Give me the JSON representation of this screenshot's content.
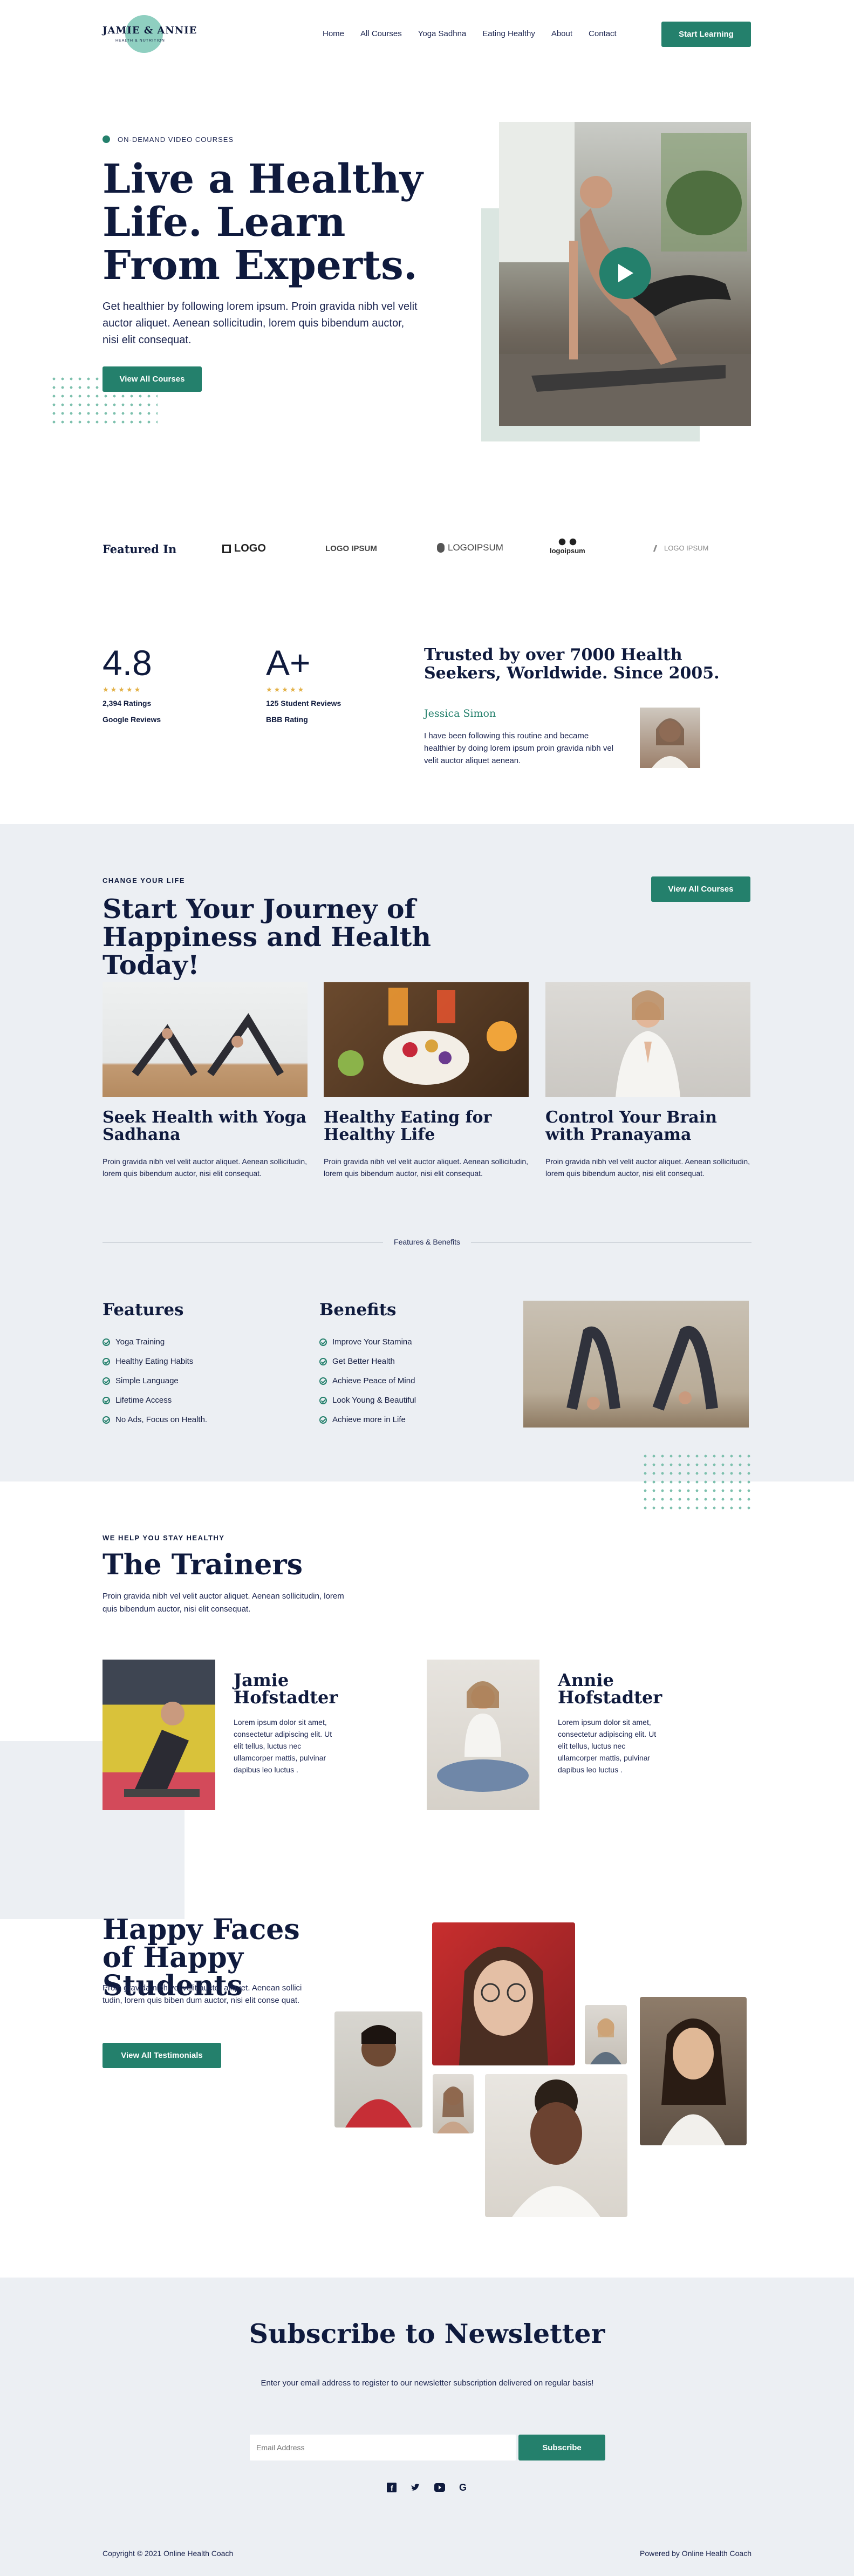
{
  "brand": {
    "name": "JAMIE & ANNIE",
    "tagline": "HEALTH & NUTRITION"
  },
  "nav": {
    "items": [
      "Home",
      "All Courses",
      "Yoga Sadhna",
      "Eating Healthy",
      "About",
      "Contact"
    ],
    "cta": "Start Learning"
  },
  "hero": {
    "eyebrow": "ON-DEMAND VIDEO COURSES",
    "title": "Live a Healthy Life. Learn From Experts.",
    "text": "Get healthier by following lorem ipsum. Proin gravida nibh vel velit auctor aliquet. Aenean sollicitudin, lorem quis bibendum auctor, nisi elit consequat.",
    "cta": "View All Courses"
  },
  "featured": {
    "label": "Featured In",
    "logos": [
      "LOGO",
      "LOGO IPSUM",
      "LOGOIPSUM",
      "logoipsum",
      "LOGO IPSUM"
    ]
  },
  "stats": {
    "rating": {
      "value": "4.8",
      "count": "2,394 Ratings",
      "source": "Google Reviews"
    },
    "grade": {
      "value": "A+",
      "count": "125 Student Reviews",
      "source": "BBB Rating"
    }
  },
  "trust": {
    "title": "Trusted by over 7000 Health Seekers, Worldwide. Since 2005.",
    "name": "Jessica Simon",
    "quote": "I have been following this routine and became healthier by doing lorem ipsum proin gravida nibh vel velit auctor aliquet aenean."
  },
  "journey": {
    "eyebrow": "CHANGE YOUR LIFE",
    "title": "Start Your Journey of Happiness and Health Today!",
    "cta": "View All Courses",
    "cards": [
      {
        "title": "Seek Health with Yoga Sadhana",
        "text": "Proin gravida nibh vel velit auctor aliquet. Aenean sollicitudin, lorem quis bibendum auctor, nisi elit consequat."
      },
      {
        "title": "Healthy Eating for Healthy Life",
        "text": "Proin gravida nibh vel velit auctor aliquet. Aenean sollicitudin, lorem quis bibendum auctor, nisi elit consequat."
      },
      {
        "title": "Control Your Brain with Pranayama",
        "text": "Proin gravida nibh vel velit auctor aliquet. Aenean sollicitudin, lorem quis bibendum auctor, nisi elit consequat."
      }
    ],
    "divider": "Features & Benefits"
  },
  "features": {
    "title": "Features",
    "items": [
      "Yoga Training",
      "Healthy Eating Habits",
      "Simple Language",
      "Lifetime Access",
      "No Ads, Focus on Health."
    ]
  },
  "benefits": {
    "title": "Benefits",
    "items": [
      "Improve Your Stamina",
      "Get Better Health",
      "Achieve Peace of Mind",
      "Look Young & Beautiful",
      "Achieve more in Life"
    ]
  },
  "trainers": {
    "eyebrow": "WE HELP YOU STAY HEALTHY",
    "title": "The Trainers",
    "text": "Proin gravida nibh vel velit auctor aliquet. Aenean sollicitudin, lorem quis bibendum auctor, nisi elit consequat.",
    "people": [
      {
        "name": "Jamie Hofstadter",
        "bio": "Lorem ipsum dolor sit amet, consectetur adipiscing elit. Ut elit tellus, luctus nec ullamcorper mattis, pulvinar dapibus leo luctus ."
      },
      {
        "name": "Annie Hofstadter",
        "bio": "Lorem ipsum dolor sit amet, consectetur adipiscing elit. Ut elit tellus, luctus nec ullamcorper mattis, pulvinar dapibus leo luctus ."
      }
    ]
  },
  "happy": {
    "title": "Happy Faces of Happy Students",
    "text": "Proin gravida nibh vel velit auctor aliquet. Aenean sollici tudin, lorem quis biben dum auctor, nisi elit conse quat.",
    "cta": "View All Testimonials"
  },
  "newsletter": {
    "title": "Subscribe to Newsletter",
    "text": "Enter your email address to register to our newsletter subscription delivered on regular basis!",
    "placeholder": "Email Address",
    "cta": "Subscribe"
  },
  "social": [
    "facebook-icon",
    "twitter-icon",
    "youtube-icon",
    "google-icon"
  ],
  "footer": {
    "copyright": "Copyright © 2021 Online Health Coach",
    "powered": "Powered by Online Health Coach"
  },
  "colors": {
    "accent": "#24806c",
    "navy": "#0f1a3d",
    "light": "#eceff3"
  }
}
